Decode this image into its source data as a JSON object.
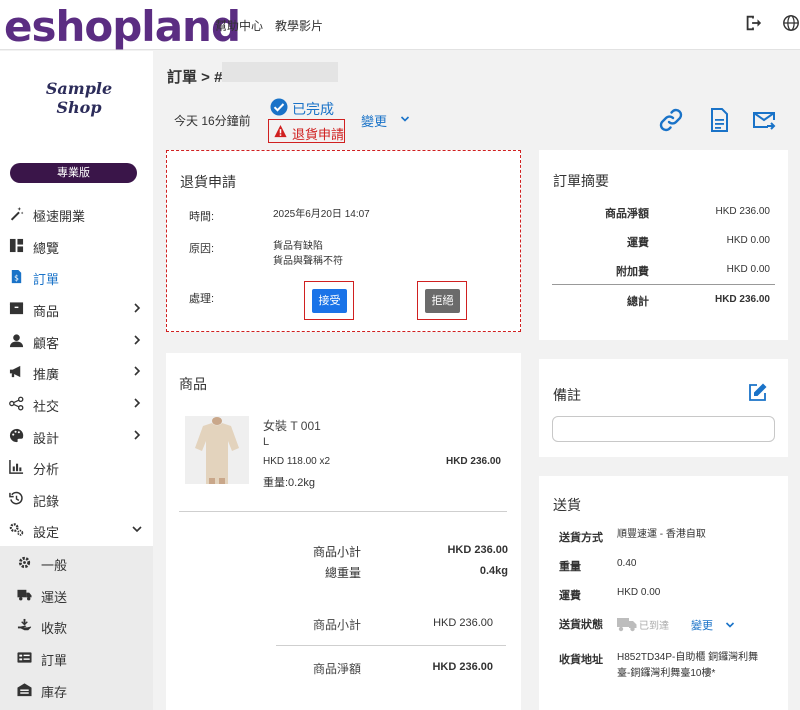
{
  "topbar": {
    "logo": "eshopland",
    "links": [
      "幫助中心",
      "教學影片"
    ]
  },
  "sidebar": {
    "shop_logo_line1": "Sample",
    "shop_logo_line2": "Shop",
    "plan": "專業版",
    "items": [
      {
        "label": "極速開業",
        "icon": "magic-wand-icon"
      },
      {
        "label": "總覽",
        "icon": "dashboard-icon"
      },
      {
        "label": "訂單",
        "icon": "order-document-icon"
      },
      {
        "label": "商品",
        "icon": "product-box-icon"
      },
      {
        "label": "顧客",
        "icon": "customer-icon"
      },
      {
        "label": "推廣",
        "icon": "megaphone-icon"
      },
      {
        "label": "社交",
        "icon": "share-icon"
      },
      {
        "label": "設計",
        "icon": "palette-icon"
      },
      {
        "label": "分析",
        "icon": "analytics-icon"
      },
      {
        "label": "記錄",
        "icon": "history-icon"
      },
      {
        "label": "設定",
        "icon": "settings-cogs-icon"
      }
    ],
    "sub_items": [
      {
        "label": "一般",
        "icon": "gear-icon"
      },
      {
        "label": "運送",
        "icon": "truck-icon"
      },
      {
        "label": "收款",
        "icon": "payment-hand-icon"
      },
      {
        "label": "訂單",
        "icon": "order-card-icon"
      },
      {
        "label": "庫存",
        "icon": "warehouse-icon"
      }
    ]
  },
  "header": {
    "breadcrumb": "訂單 > #",
    "time_ago": "今天 16分鐘前",
    "status_done": "已完成",
    "status_return": "退貨申請",
    "change": "變更"
  },
  "return_request": {
    "title": "退貨申請",
    "time_label": "時間:",
    "time_value": "2025年6月20日 14:07",
    "reason_label": "原因:",
    "reason_line1": "貨品有缺陷",
    "reason_line2": "貨品與聲稱不符",
    "action_label": "處理:",
    "accept": "接受",
    "reject": "拒絕"
  },
  "products": {
    "title": "商品",
    "item": {
      "name": "女裝 T 001",
      "variant": "L",
      "price_qty": "HKD 118.00 x2",
      "weight": "重量:0.2kg",
      "total": "HKD 236.00"
    },
    "subtotal_label": "商品小計",
    "subtotal_value": "HKD 236.00",
    "total_weight_label": "總重量",
    "total_weight_value": "0.4kg",
    "subtotal2_label": "商品小計",
    "subtotal2_value": "HKD 236.00",
    "net_label": "商品淨額",
    "net_value": "HKD 236.00"
  },
  "summary": {
    "title": "訂單摘要",
    "rows": [
      {
        "label": "商品淨額",
        "value": "HKD 236.00"
      },
      {
        "label": "運費",
        "value": "HKD 0.00"
      },
      {
        "label": "附加費",
        "value": "HKD 0.00"
      }
    ],
    "total_label": "總計",
    "total_value": "HKD 236.00"
  },
  "notes": {
    "title": "備註",
    "value": ""
  },
  "shipping": {
    "title": "送貨",
    "method_label": "送貨方式",
    "method_value": "順豐速運 - 香港自取",
    "weight_label": "重量",
    "weight_value": "0.40",
    "fee_label": "運費",
    "fee_value": "HKD 0.00",
    "status_label": "送貨狀態",
    "status_value": "已到達",
    "status_change": "變更",
    "address_label": "收貨地址",
    "address_line1": "H852TD34P-自助櫃 銅鑼灣利舞",
    "address_line2": "臺-銅鑼灣利舞臺10樓*"
  },
  "colors": {
    "brand": "#5b2d82",
    "accent": "#1a73c8",
    "alert": "#d02020",
    "plan_badge": "#3a1549",
    "reject_button": "#6b6b6b"
  }
}
